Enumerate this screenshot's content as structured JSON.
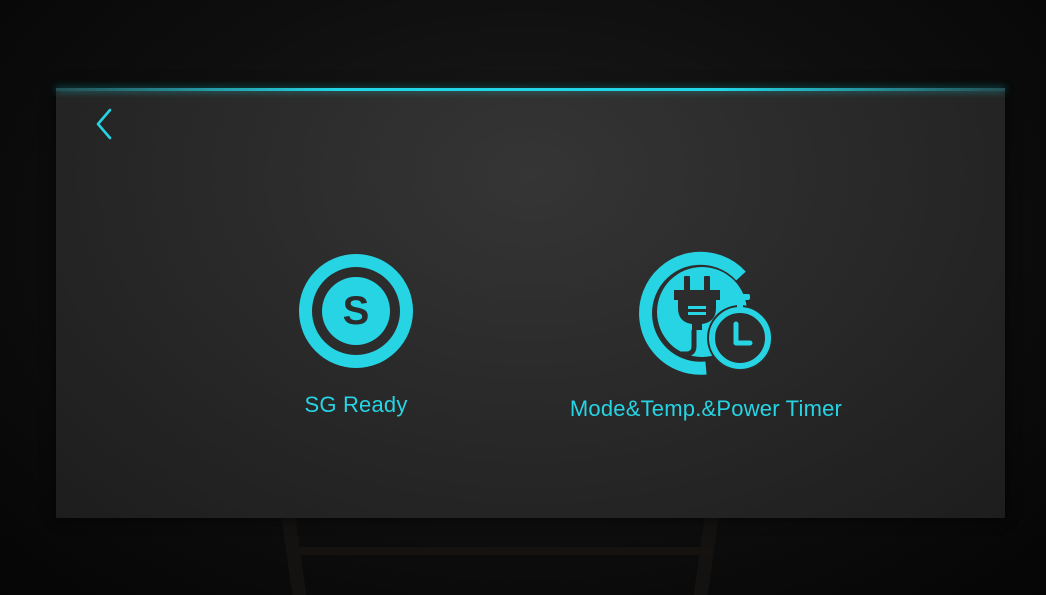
{
  "colors": {
    "accent": "#26d4e4",
    "panel": "#2a2a2a",
    "background": "#0b0b0b"
  },
  "header": {
    "back_icon": "chevron-left-icon"
  },
  "tiles": [
    {
      "label": "SG Ready",
      "icon": "sg-ready-icon"
    },
    {
      "label": "Mode&Temp.&Power Timer",
      "icon": "plug-timer-icon"
    }
  ]
}
